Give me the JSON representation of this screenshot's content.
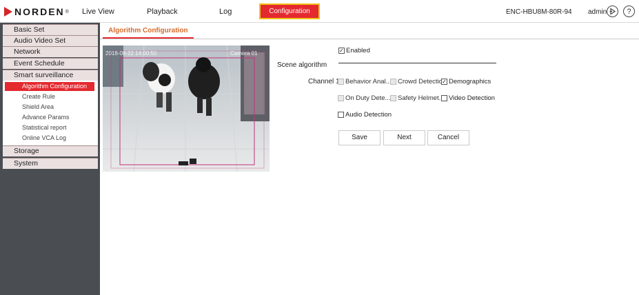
{
  "header": {
    "logo_text": "NORDEN",
    "logo_mark": "®",
    "nav": {
      "live_view": "Live View",
      "playback": "Playback",
      "log": "Log",
      "configuration": "Configuration"
    },
    "device_name": "ENC-HBU8M-80R-94",
    "user": "admin",
    "logout_icon": "logout-icon",
    "help_icon": "help-icon",
    "help_glyph": "?"
  },
  "sidebar": {
    "basic_set": "Basic Set",
    "audio_video_set": "Audio Video Set",
    "network": "Network",
    "event_schedule": "Event Schedule",
    "smart_surveillance": "Smart surveillance",
    "sub_items": [
      "Algorithm Configuration",
      "Create Rule",
      "Shield Area",
      "Advance Params",
      "Statistical report",
      "Online VCA Log"
    ],
    "storage": "Storage",
    "system": "System"
  },
  "tab": {
    "title": "Algorithm Configuration"
  },
  "form": {
    "enabled_label": "Enabled",
    "enabled_checked": true,
    "scene_algorithm_label": "Scene algorithm",
    "channel_label": "Channel 1",
    "options": {
      "behavior_analysis": "Behavior Anal...",
      "crowd_detection": "Crowd Detection",
      "demographics": "Demographics",
      "on_duty_detection": "On Duty Dete...",
      "safety_helmet": "Safety Helmet...",
      "video_detection": "Video Detection",
      "audio_detection": "Audio Detection"
    },
    "demographics_checked": true,
    "buttons": {
      "save": "Save",
      "next": "Next",
      "cancel": "Cancel"
    }
  },
  "colors": {
    "brand_red": "#e4292f",
    "highlight_yellow": "#f0c419",
    "sidebar_bg": "#4a4e52",
    "tab_text": "#d86a2a"
  }
}
